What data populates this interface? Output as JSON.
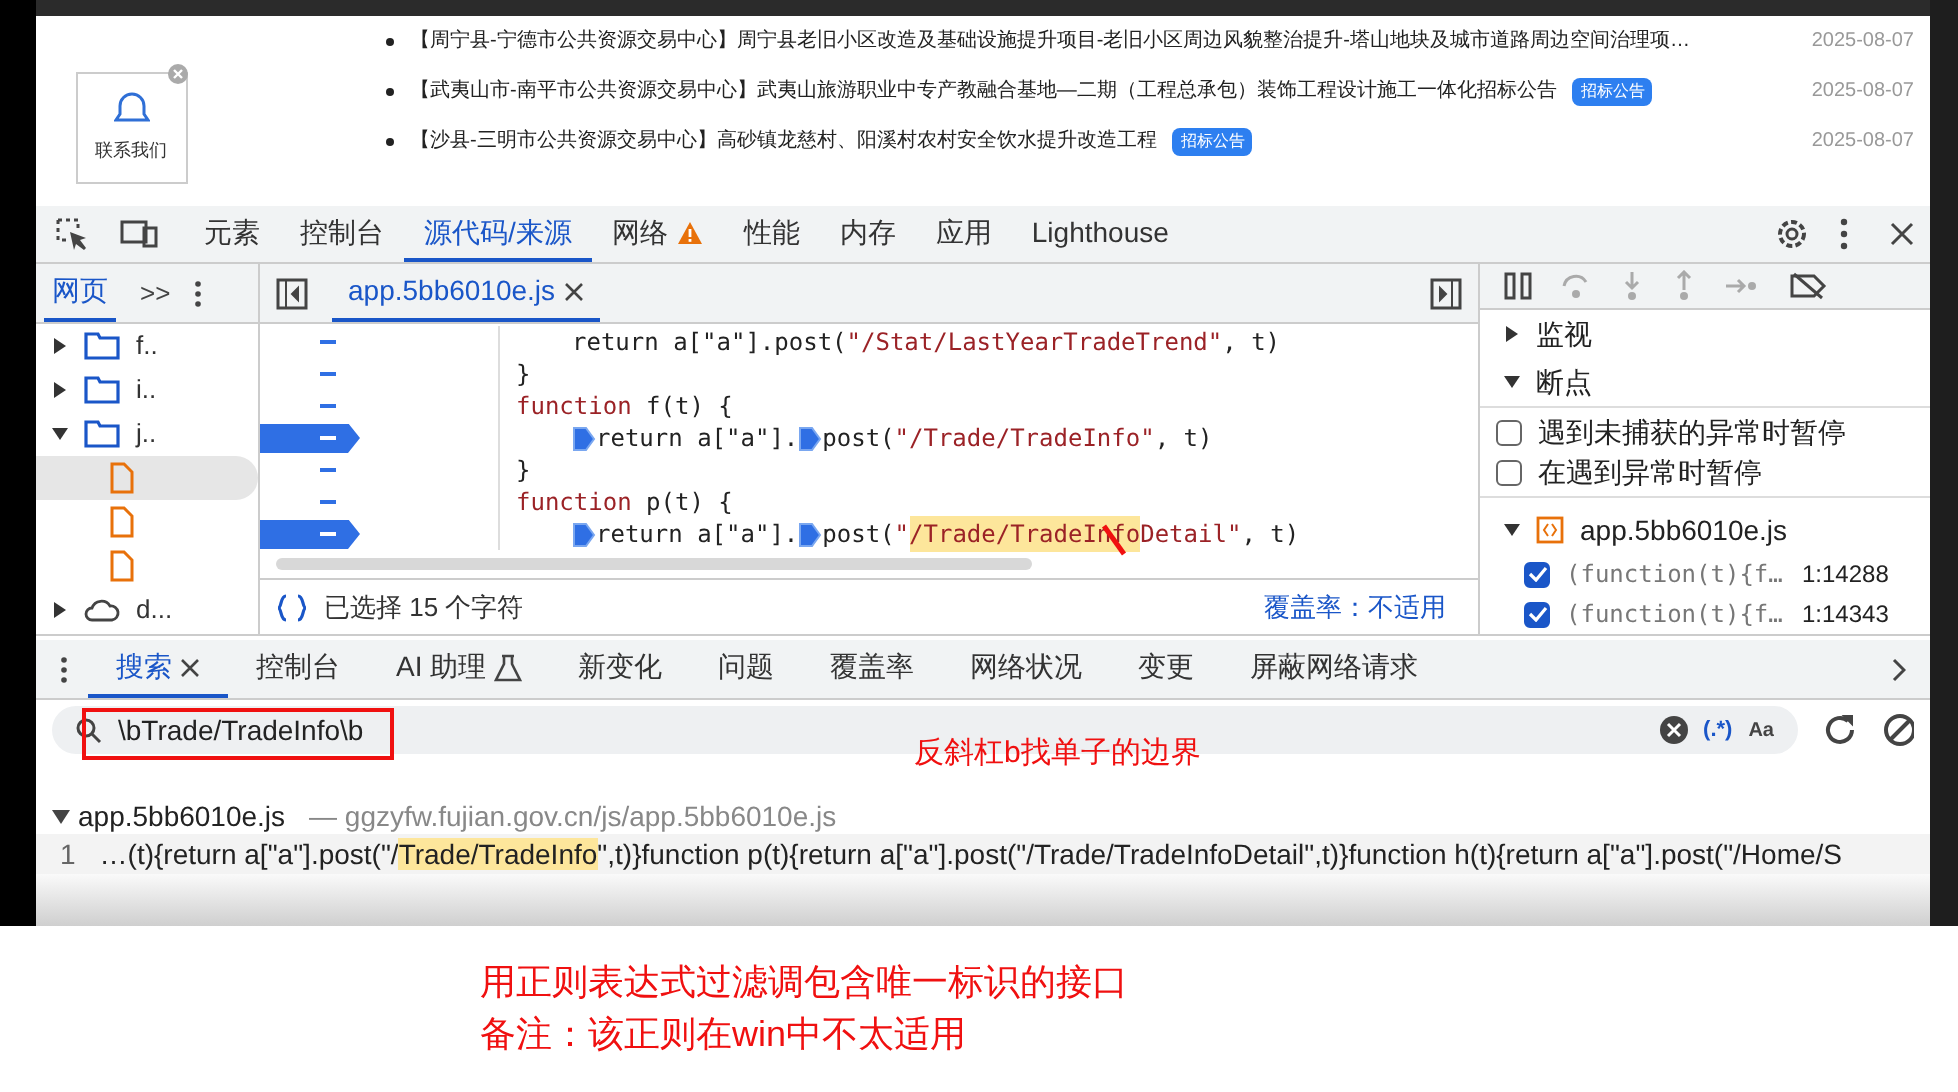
{
  "page": {
    "items": [
      {
        "text": "【周宁县-宁德市公共资源交易中心】周宁县老旧小区改造及基础设施提升项目-老旧小区周边风貌整治提升-塔山地块及城市道路周边空间治理项…",
        "date": "2025-08-07"
      },
      {
        "text": "【武夷山市-南平市公共资源交易中心】武夷山旅游职业中专产教融合基地—二期（工程总承包）装饰工程设计施工一体化招标公告",
        "badge": "招标公告",
        "date": "2025-08-07"
      },
      {
        "text": "【沙县-三明市公共资源交易中心】高砂镇龙慈村、阳溪村农村安全饮水提升改造工程",
        "badge": "招标公告",
        "date": "2025-08-07"
      }
    ],
    "contact": {
      "label": "联系我们"
    }
  },
  "devtools": {
    "tabs": [
      {
        "label": "元素",
        "selected": false
      },
      {
        "label": "控制台",
        "selected": false
      },
      {
        "label": "源代码/来源",
        "selected": true
      },
      {
        "label": "网络",
        "selected": false,
        "warning": true
      },
      {
        "label": "性能",
        "selected": false
      },
      {
        "label": "内存",
        "selected": false
      },
      {
        "label": "应用",
        "selected": false
      },
      {
        "label": "Lighthouse",
        "selected": false
      }
    ],
    "navigator": {
      "tab": "网页",
      "more": ">>",
      "tree": [
        {
          "label": "f..",
          "kind": "folder",
          "expanded": false
        },
        {
          "label": "i..",
          "kind": "folder",
          "expanded": false
        },
        {
          "label": "j..",
          "kind": "folder",
          "expanded": true,
          "children": [
            {
              "kind": "file",
              "selected": true
            },
            {
              "kind": "file",
              "selected": false
            },
            {
              "kind": "file",
              "selected": false
            }
          ]
        },
        {
          "label": "d...",
          "kind": "domain",
          "expanded": false
        }
      ]
    },
    "editor": {
      "file_tab": "app.5bb6010e.js",
      "lines": [
        {
          "breakpoint": false,
          "nested": true,
          "parts": [
            {
              "kind": "plain",
              "text": "return a[\"a\"].post("
            },
            {
              "kind": "string",
              "text": "\"/Stat/LastYearTradeTrend\""
            },
            {
              "kind": "plain",
              "text": ", t)"
            }
          ]
        },
        {
          "breakpoint": false,
          "nested": false,
          "parts": [
            {
              "kind": "plain",
              "text": "}"
            }
          ]
        },
        {
          "breakpoint": false,
          "nested": false,
          "parts": [
            {
              "kind": "keyword",
              "text": "function"
            },
            {
              "kind": "plain",
              "text": " f(t) {"
            }
          ]
        },
        {
          "breakpoint": true,
          "nested": true,
          "parts": [
            {
              "kind": "marker"
            },
            {
              "kind": "plain",
              "text": "return a[\"a\"]."
            },
            {
              "kind": "marker"
            },
            {
              "kind": "plain",
              "text": "post("
            },
            {
              "kind": "string",
              "text": "\"/Trade/TradeInfo\""
            },
            {
              "kind": "plain",
              "text": ", t)"
            }
          ]
        },
        {
          "breakpoint": false,
          "nested": false,
          "parts": [
            {
              "kind": "plain",
              "text": "}"
            }
          ]
        },
        {
          "breakpoint": false,
          "nested": false,
          "parts": [
            {
              "kind": "keyword",
              "text": "function"
            },
            {
              "kind": "plain",
              "text": " p(t) {"
            }
          ]
        },
        {
          "breakpoint": true,
          "nested": true,
          "parts": [
            {
              "kind": "marker"
            },
            {
              "kind": "plain",
              "text": "return a[\"a\"]."
            },
            {
              "kind": "marker"
            },
            {
              "kind": "plain",
              "text": "post("
            },
            {
              "kind": "string",
              "text": "\""
            },
            {
              "kind": "match",
              "text": "/Trade/TradeInfo"
            },
            {
              "kind": "string",
              "text": "Detail\""
            },
            {
              "kind": "plain",
              "text": ", t)"
            }
          ]
        }
      ],
      "selection": "已选择 15 个字符",
      "coverage": "覆盖率：不适用"
    },
    "debugger": {
      "sections": [
        {
          "label": "监视",
          "expanded": false
        },
        {
          "label": "断点",
          "expanded": true
        }
      ],
      "options": [
        {
          "label": "遇到未捕获的异常时暂停",
          "checked": false
        },
        {
          "label": "在遇到异常时暂停",
          "checked": false
        }
      ],
      "file": "app.5bb6010e.js",
      "breakpoints": [
        {
          "code": "(function(t){f…",
          "location": "1:14288",
          "checked": true
        },
        {
          "code": "(function(t){f…",
          "location": "1:14343",
          "checked": true
        }
      ]
    },
    "drawer": {
      "tabs": [
        {
          "label": "搜索",
          "selected": true,
          "closable": true
        },
        {
          "label": "控制台",
          "selected": false
        },
        {
          "label": "AI 助理",
          "selected": false,
          "lab": true
        },
        {
          "label": "新变化",
          "selected": false
        },
        {
          "label": "问题",
          "selected": false
        },
        {
          "label": "覆盖率",
          "selected": false
        },
        {
          "label": "网络状况",
          "selected": false
        },
        {
          "label": "变更",
          "selected": false
        },
        {
          "label": "屏蔽网络请求",
          "selected": false
        }
      ],
      "search": {
        "value": "\\bTrade/TradeInfo\\b",
        "regex": true,
        "regex_label": "(.*)",
        "case_label": "Aa"
      },
      "result": {
        "file": "app.5bb6010e.js",
        "path": "— ggzyfw.fujian.gov.cn/js/app.5bb6010e.js",
        "line": "1",
        "before": "…(t){return a[\"a\"].post(\"/",
        "match": "Trade/TradeInfo",
        "after": "\",t)}function p(t){return a[\"a\"].post(\"/Trade/TradeInfoDetail\",t)}function h(t){return a[\"a\"].post(\"/Home/S"
      }
    }
  },
  "annotations": {
    "side_note": "反斜杠b找单子的边界",
    "notes": [
      "用正则表达式过滤调包含唯一标识的接口",
      "备注：该正则在win中不太适用"
    ]
  }
}
